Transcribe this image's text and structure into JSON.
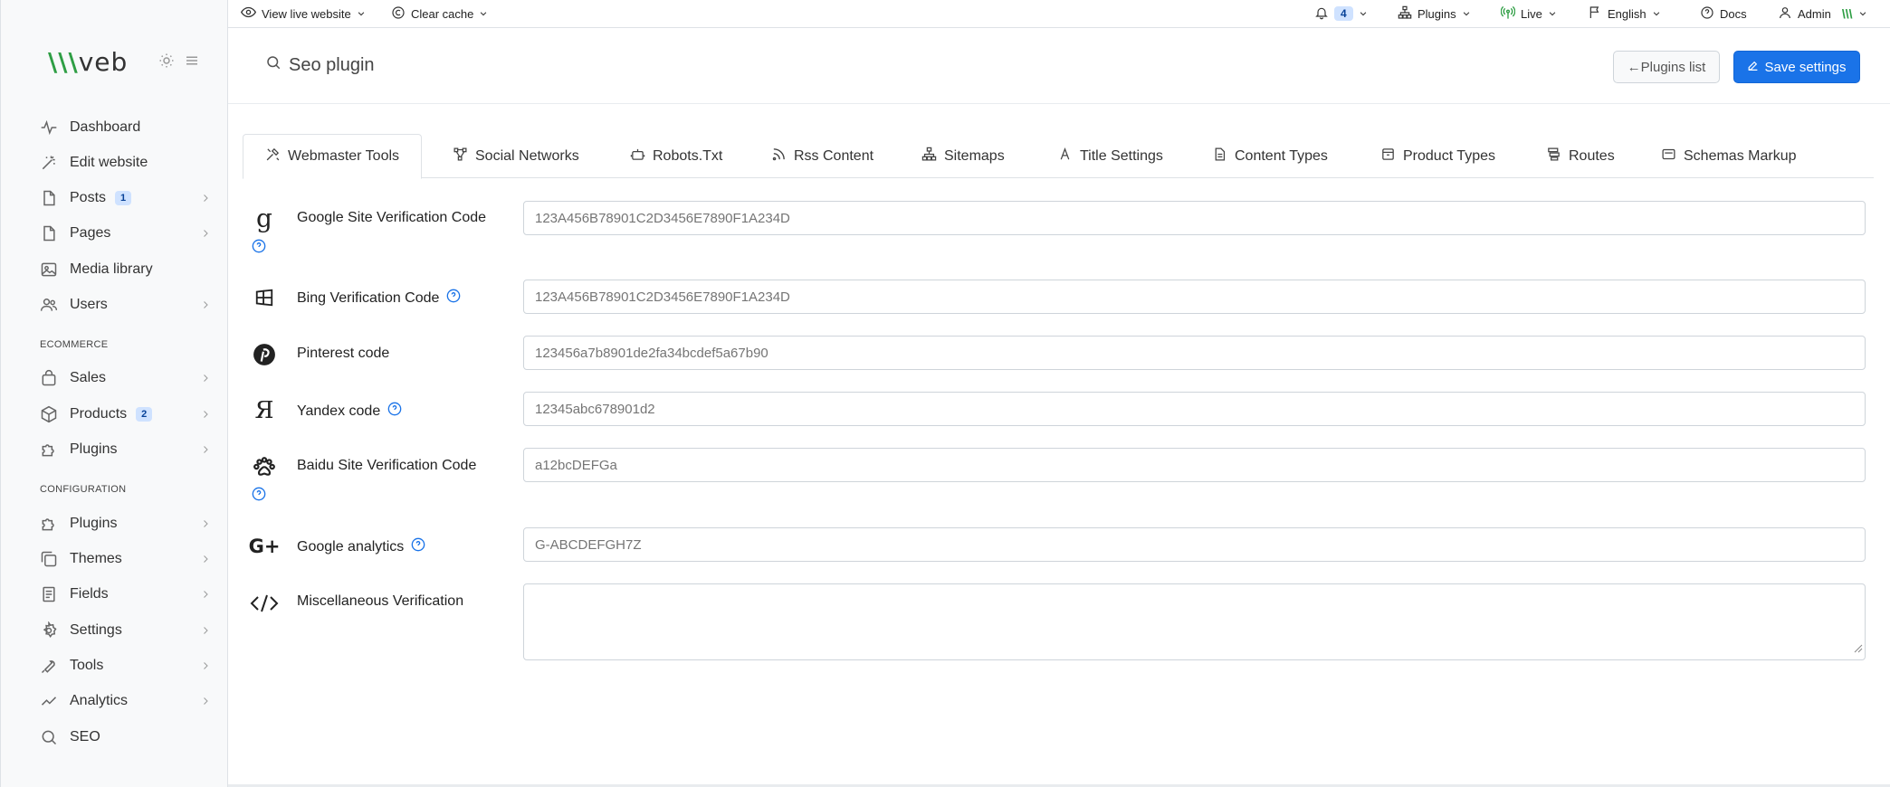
{
  "sidebar": {
    "logo": {
      "mark": "\\\\\\",
      "text": "veb"
    },
    "items": [
      {
        "label": "Dashboard",
        "icon": "activity-icon"
      },
      {
        "label": "Edit website",
        "icon": "magic-wand-icon"
      },
      {
        "label": "Posts",
        "icon": "file-icon",
        "badge": "1"
      },
      {
        "label": "Pages",
        "icon": "file-icon"
      },
      {
        "label": "Media library",
        "icon": "image-icon"
      },
      {
        "label": "Users",
        "icon": "users-icon"
      }
    ],
    "section_ecommerce": "ECOMMERCE",
    "ecommerce_items": [
      {
        "label": "Sales",
        "icon": "shopping-bag-icon"
      },
      {
        "label": "Products",
        "icon": "box-icon",
        "badge": "2"
      },
      {
        "label": "Plugins",
        "icon": "puzzle-icon"
      }
    ],
    "section_configuration": "CONFIGURATION",
    "configuration_items": [
      {
        "label": "Plugins",
        "icon": "puzzle-icon"
      },
      {
        "label": "Themes",
        "icon": "copy-icon"
      },
      {
        "label": "Fields",
        "icon": "form-icon"
      },
      {
        "label": "Settings",
        "icon": "gear-icon"
      },
      {
        "label": "Tools",
        "icon": "wrench-icon"
      },
      {
        "label": "Analytics",
        "icon": "chart-line-icon"
      },
      {
        "label": "SEO",
        "icon": "search-icon"
      }
    ]
  },
  "topbar": {
    "view_live": "View live website",
    "clear_cache": "Clear cache",
    "notifications_count": "4",
    "plugins": "Plugins",
    "live": "Live",
    "language": "English",
    "docs": "Docs",
    "admin": "Admin"
  },
  "header": {
    "search_title": "Seo plugin",
    "plugins_list_button": "←Plugins list",
    "save_button": "Save settings"
  },
  "tabs": [
    {
      "label": "Webmaster Tools",
      "active": true
    },
    {
      "label": "Social Networks"
    },
    {
      "label": "Robots.Txt"
    },
    {
      "label": "Rss Content"
    },
    {
      "label": "Sitemaps"
    },
    {
      "label": "Title Settings"
    },
    {
      "label": "Content Types"
    },
    {
      "label": "Product Types"
    },
    {
      "label": "Routes"
    },
    {
      "label": "Schemas Markup"
    }
  ],
  "form": {
    "google": {
      "label": "Google Site Verification Code",
      "placeholder": "123A456B78901C2D3456E7890F1A234D"
    },
    "bing": {
      "label": "Bing Verification Code",
      "placeholder": "123A456B78901C2D3456E7890F1A234D"
    },
    "pinterest": {
      "label": "Pinterest code",
      "placeholder": "123456a7b8901de2fa34bcdef5a67b90"
    },
    "yandex": {
      "label": "Yandex code",
      "placeholder": "12345abc678901d2"
    },
    "baidu": {
      "label": "Baidu Site Verification Code",
      "placeholder": "a12bcDEFGa"
    },
    "analytics": {
      "label": "Google analytics",
      "placeholder": "G-ABCDEFGH7Z"
    },
    "misc": {
      "label": "Miscellaneous Verification",
      "value": ""
    }
  },
  "colors": {
    "accent": "#1a73e8",
    "brand_green": "#2e9e44",
    "help_blue": "#1a73e8"
  }
}
